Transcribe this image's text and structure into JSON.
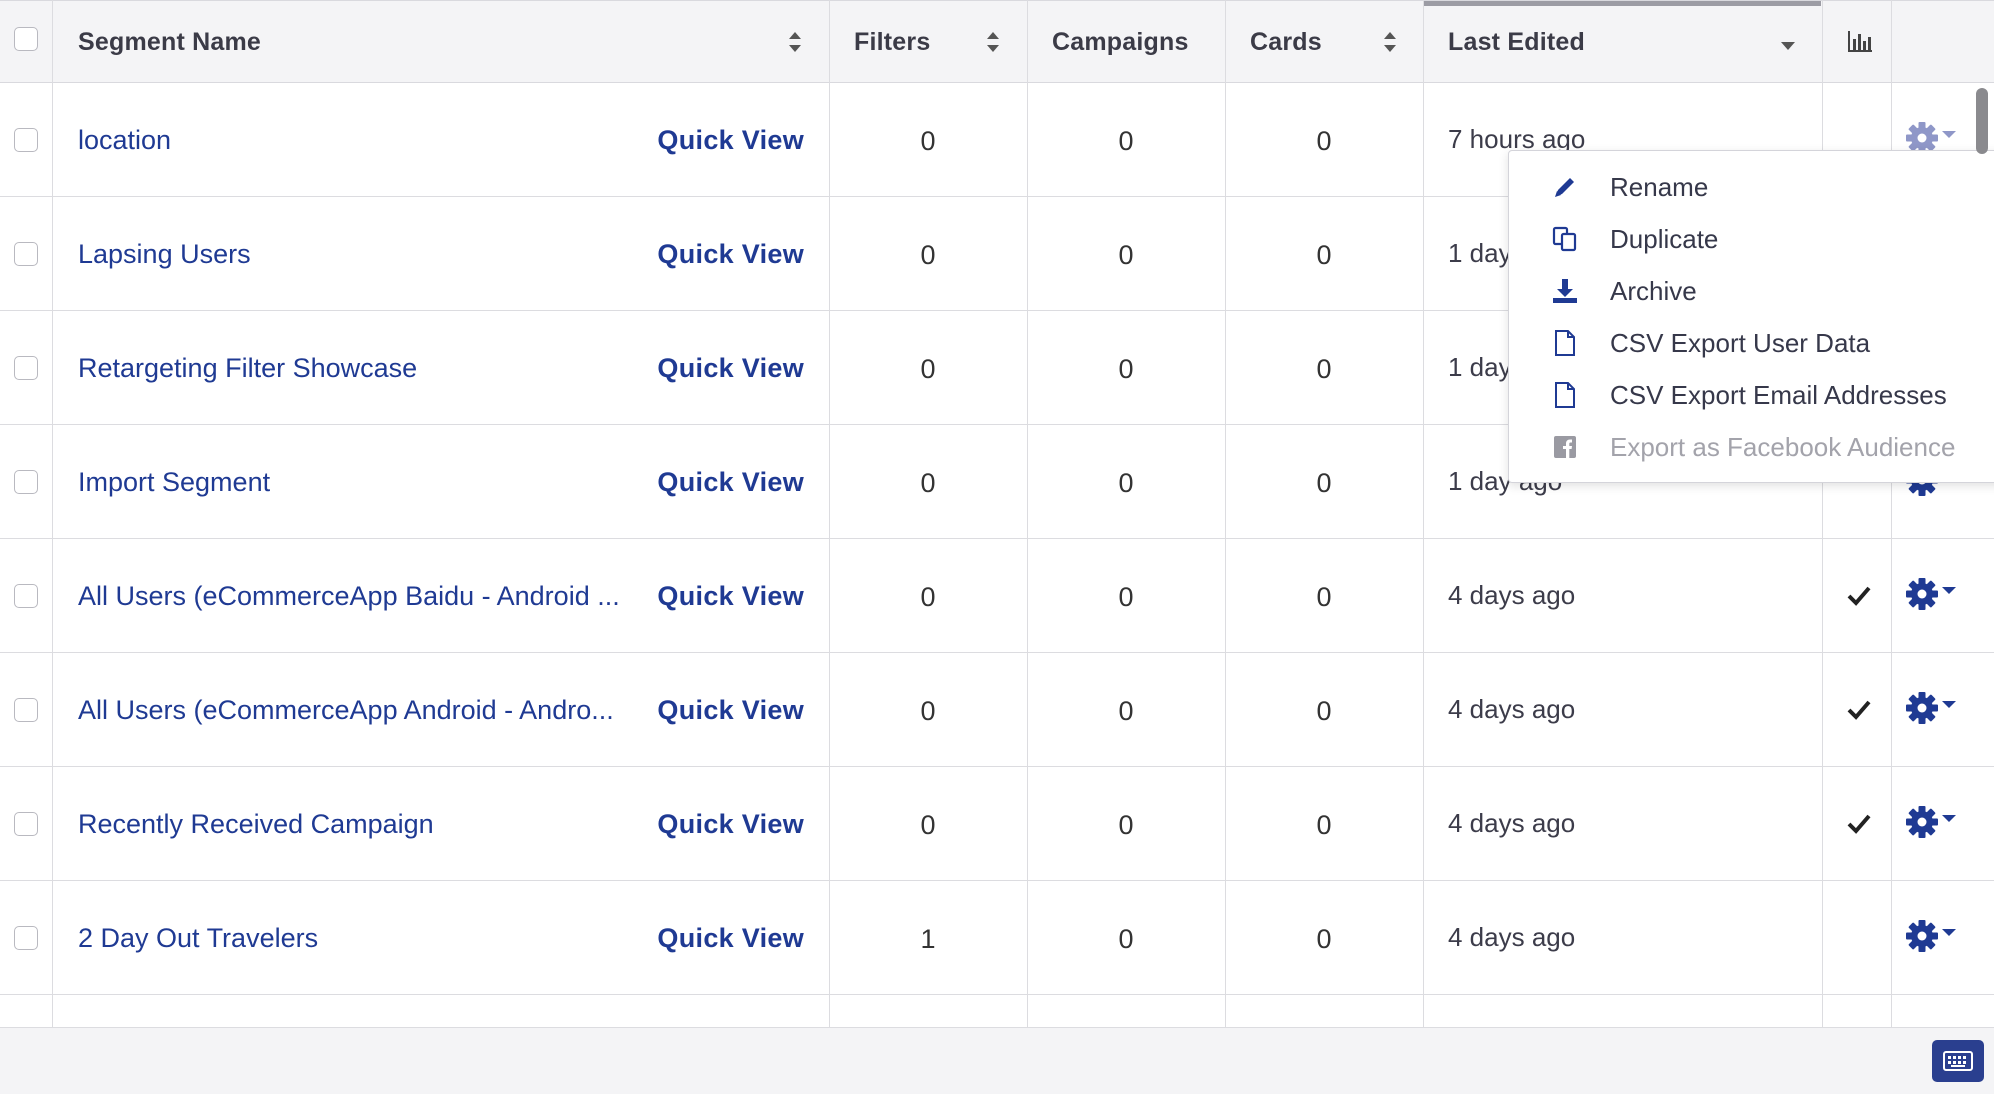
{
  "header": {
    "segment_name": "Segment Name",
    "filters": "Filters",
    "campaigns": "Campaigns",
    "cards": "Cards",
    "last_edited": "Last Edited"
  },
  "rows": [
    {
      "name": "location",
      "quick_view": "Quick View",
      "filters": "0",
      "campaigns": "0",
      "cards": "0",
      "edited": "7 hours ago",
      "checked": false
    },
    {
      "name": "Lapsing Users",
      "quick_view": "Quick View",
      "filters": "0",
      "campaigns": "0",
      "cards": "0",
      "edited": "1 day",
      "checked": false
    },
    {
      "name": "Retargeting Filter Showcase",
      "quick_view": "Quick View",
      "filters": "0",
      "campaigns": "0",
      "cards": "0",
      "edited": "1 day",
      "checked": false
    },
    {
      "name": "Import Segment",
      "quick_view": "Quick View",
      "filters": "0",
      "campaigns": "0",
      "cards": "0",
      "edited": "1 day ago",
      "checked": false
    },
    {
      "name": "All Users (eCommerceApp Baidu - Android ...",
      "quick_view": "Quick View",
      "filters": "0",
      "campaigns": "0",
      "cards": "0",
      "edited": "4 days ago",
      "checked": true
    },
    {
      "name": "All Users (eCommerceApp Android - Andro...",
      "quick_view": "Quick View",
      "filters": "0",
      "campaigns": "0",
      "cards": "0",
      "edited": "4 days ago",
      "checked": true
    },
    {
      "name": "Recently Received Campaign",
      "quick_view": "Quick View",
      "filters": "0",
      "campaigns": "0",
      "cards": "0",
      "edited": "4 days ago",
      "checked": true
    },
    {
      "name": "2 Day Out Travelers",
      "quick_view": "Quick View",
      "filters": "1",
      "campaigns": "0",
      "cards": "0",
      "edited": "4 days ago",
      "checked": false
    }
  ],
  "menu": {
    "items": [
      {
        "label": "Rename",
        "icon": "pencil-icon",
        "disabled": false
      },
      {
        "label": "Duplicate",
        "icon": "duplicate-icon",
        "disabled": false
      },
      {
        "label": "Archive",
        "icon": "archive-icon",
        "disabled": false
      },
      {
        "label": "CSV Export User Data",
        "icon": "file-icon",
        "disabled": false
      },
      {
        "label": "CSV Export Email Addresses",
        "icon": "file-icon",
        "disabled": false
      },
      {
        "label": "Export as Facebook Audience",
        "icon": "facebook-icon",
        "disabled": true
      }
    ]
  },
  "colors": {
    "link": "#1f3a93",
    "header_bg": "#f4f4f6",
    "disabled_text": "#a3a3ab",
    "keyboard_button": "#2a3f8f"
  },
  "icons": {
    "stats": "bar-chart-icon",
    "gear": "gear-icon",
    "check": "checkmark-icon",
    "keyboard": "keyboard-icon"
  }
}
